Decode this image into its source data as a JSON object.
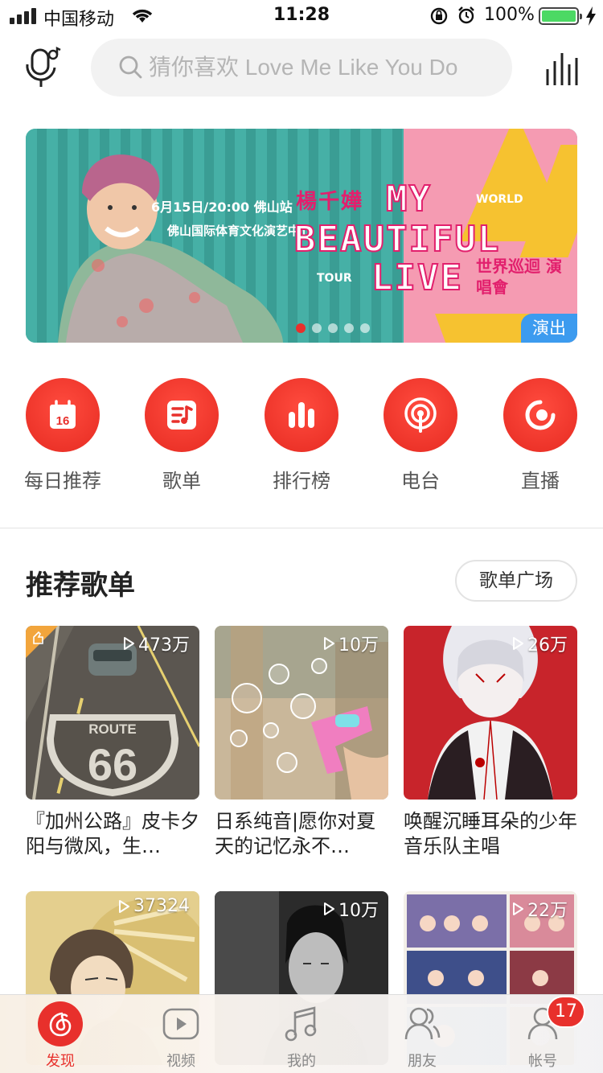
{
  "status_bar": {
    "carrier": "中国移动",
    "time": "11:28",
    "battery": "100%"
  },
  "search": {
    "placeholder": "猜你喜欢 Love Me Like You Do"
  },
  "banner": {
    "date_line": "6月15日/20:00 佛山站",
    "venue": "佛山国际体育文化演艺中心",
    "singer": "楊千嬅",
    "line1": "MY",
    "world": "WORLD",
    "line2": "BEAUTIFUL",
    "tour": "TOUR",
    "line3": "LIVE",
    "cn_tour": "世界巡迴 演唱會",
    "tag": "演出",
    "dots_total": 5,
    "dots_active": 0
  },
  "shortcuts": [
    {
      "label": "每日推荐",
      "icon": "calendar-icon",
      "day": "16"
    },
    {
      "label": "歌单",
      "icon": "playlist-icon"
    },
    {
      "label": "排行榜",
      "icon": "ranking-icon"
    },
    {
      "label": "电台",
      "icon": "radio-icon"
    },
    {
      "label": "直播",
      "icon": "live-icon"
    }
  ],
  "section": {
    "title": "推荐歌单",
    "button": "歌单广场"
  },
  "playlists": [
    {
      "plays": "473万",
      "title": "『加州公路』皮卡夕阳与微风，生…"
    },
    {
      "plays": "10万",
      "title": "日系纯音|愿你对夏天的记忆永不…"
    },
    {
      "plays": "26万",
      "title": "唤醒沉睡耳朵的少年音乐队主唱"
    },
    {
      "plays": "37324",
      "title": ""
    },
    {
      "plays": "10万",
      "title": ""
    },
    {
      "plays": "22万",
      "title": ""
    }
  ],
  "tabs": [
    {
      "label": "发现",
      "icon": "netease-music-icon",
      "active": true
    },
    {
      "label": "视频",
      "icon": "video-icon"
    },
    {
      "label": "我的",
      "icon": "music-note-icon"
    },
    {
      "label": "朋友",
      "icon": "friends-icon"
    },
    {
      "label": "帐号",
      "icon": "account-icon"
    }
  ],
  "account_badge": "17",
  "colors": {
    "accent": "#e8302c",
    "banner_tag": "#3c9bef"
  }
}
